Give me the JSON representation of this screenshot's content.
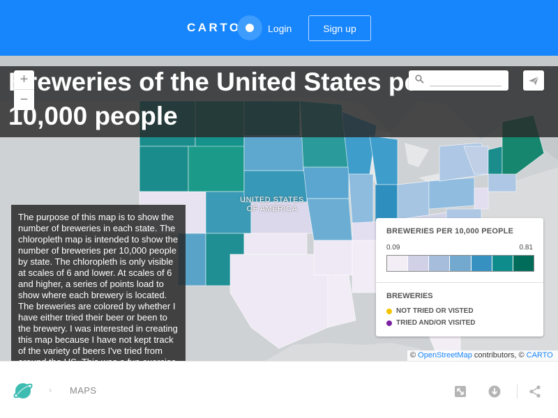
{
  "header": {
    "logo_text": "CARTO",
    "login_label": "Login",
    "signup_label": "Sign up",
    "brand_color": "#1785fb"
  },
  "map": {
    "title": "Breweries of the United States per 10,000 people",
    "country_label_line1": "UNITED STATES",
    "country_label_line2": "OF AMERICA",
    "zoom_in_label": "+",
    "zoom_out_label": "−",
    "search_placeholder": "",
    "description": "The purpose of this map is to show the number of breweries in each state. The chloropleth map is intend­ed to show the number of breweries per 10,000 people by state. The chloropleth is only visible at scales of 6 and lower. At scales of 6 and higher, a series of points load to show where each brewery is locat­ed. The breweries are colored by whether I have either tried their beer or been to the brewery. I was inter­ested in creating this map because I have not kept track of the variety of beers I've tried from around the US. This was a fun exercise that empha­sized to me that I most try beers from where I am living at the time."
  },
  "legend": {
    "choropleth_title": "BREWERIES PER 10,000 PEOPLE",
    "min_label": "0.09",
    "max_label": "0.81",
    "ramp_colors": [
      "#f3eef6",
      "#d0d1e6",
      "#a6bddb",
      "#74a9cf",
      "#3690c0",
      "#0e8c8c",
      "#016c59"
    ],
    "points_title": "BREWERIES",
    "items": [
      {
        "label": "NOT TRIED OR VISTED",
        "color": "#f4c300"
      },
      {
        "label": "TRIED AND/OR VISITED",
        "color": "#7b1fa2"
      }
    ]
  },
  "attribution": {
    "prefix": "© ",
    "osm_link": "OpenStreetMap",
    "middle": " contributors, © ",
    "carto_link": "CARTO"
  },
  "footer": {
    "breadcrumb_chevron": "›",
    "maps_label": "MAPS",
    "icons": [
      "planet-icon",
      "fullscreen-icon",
      "download-icon",
      "share-icon"
    ]
  }
}
